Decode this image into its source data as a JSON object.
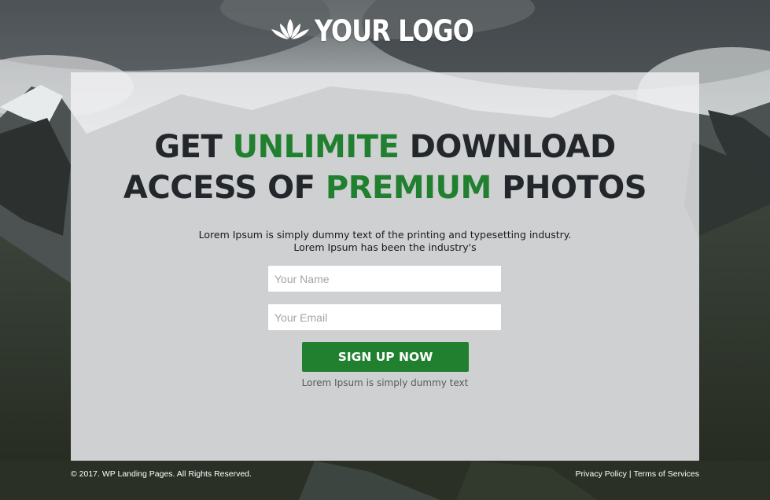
{
  "logo": {
    "text": "YOUR LOGO",
    "icon": "lotus-icon"
  },
  "hero": {
    "line1_pre": "GET ",
    "line1_accent": "UNLIMITE",
    "line1_post": " DOWNLOAD",
    "line2_pre": "ACCESS OF ",
    "line2_accent": "PREMIUM",
    "line2_post": " PHOTOS"
  },
  "subtext": {
    "line1": "Lorem Ipsum is simply dummy text of the printing and typesetting industry.",
    "line2": "Lorem Ipsum has been the industry's"
  },
  "form": {
    "name_placeholder": "Your Name",
    "name_value": "",
    "email_placeholder": "Your Email",
    "email_value": "",
    "submit_label": "SIGN UP NOW",
    "note": "Lorem Ipsum is simply dummy text"
  },
  "footer": {
    "copyright": "© 2017. WP Landing Pages. All Rights Reserved.",
    "privacy_label": "Privacy Policy",
    "separator": "|",
    "terms_label": "Terms of Services"
  },
  "colors": {
    "accent": "#21802f",
    "headline": "#23272b",
    "card": "#f3f4f5"
  }
}
